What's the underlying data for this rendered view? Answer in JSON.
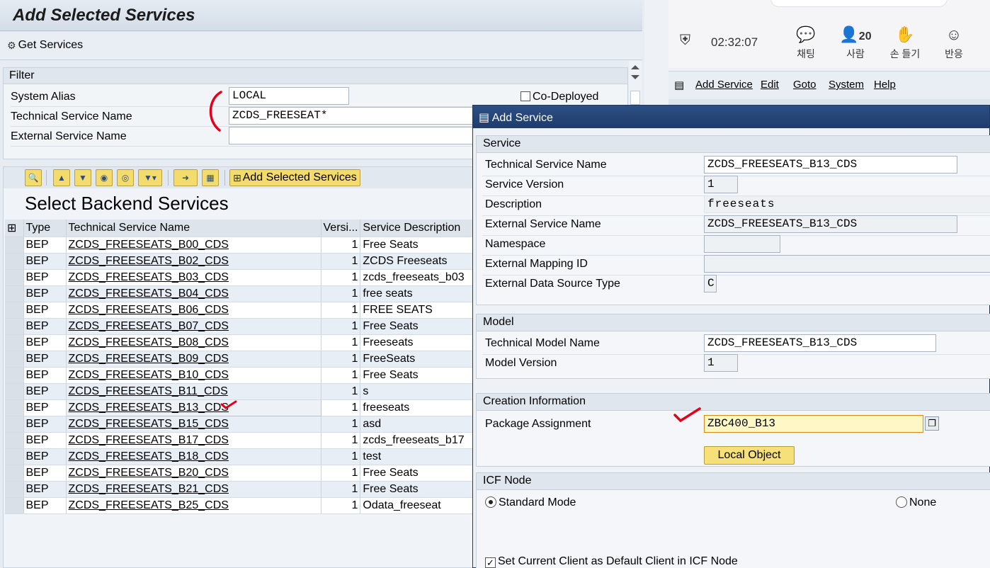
{
  "main_window": {
    "title": "Add Selected Services",
    "get_services_label": "Get Services"
  },
  "filter": {
    "header": "Filter",
    "system_alias_label": "System Alias",
    "system_alias_value": "LOCAL",
    "technical_service_name_label": "Technical Service Name",
    "technical_service_name_value": "ZCDS_FREESEAT*",
    "external_service_name_label": "External Service Name",
    "external_service_name_value": "",
    "co_deployed_label": "Co-Deployed"
  },
  "toolbar": {
    "add_selected_services_label": "Add Selected Services"
  },
  "grid": {
    "title": "Select Backend Services",
    "columns": [
      "Type",
      "Technical Service Name",
      "Versi...",
      "Service Description"
    ],
    "rows": [
      {
        "type": "BEP",
        "name": "ZCDS_FREESEATS_B00_CDS",
        "version": "1",
        "description": "Free Seats"
      },
      {
        "type": "BEP",
        "name": "ZCDS_FREESEATS_B02_CDS",
        "version": "1",
        "description": "ZCDS Freeseats"
      },
      {
        "type": "BEP",
        "name": "ZCDS_FREESEATS_B03_CDS",
        "version": "1",
        "description": "zcds_freeseats_b03"
      },
      {
        "type": "BEP",
        "name": "ZCDS_FREESEATS_B04_CDS",
        "version": "1",
        "description": "free seats"
      },
      {
        "type": "BEP",
        "name": "ZCDS_FREESEATS_B06_CDS",
        "version": "1",
        "description": "FREE SEATS"
      },
      {
        "type": "BEP",
        "name": "ZCDS_FREESEATS_B07_CDS",
        "version": "1",
        "description": "Free Seats"
      },
      {
        "type": "BEP",
        "name": "ZCDS_FREESEATS_B08_CDS",
        "version": "1",
        "description": "Freeseats"
      },
      {
        "type": "BEP",
        "name": "ZCDS_FREESEATS_B09_CDS",
        "version": "1",
        "description": "FreeSeats"
      },
      {
        "type": "BEP",
        "name": "ZCDS_FREESEATS_B10_CDS",
        "version": "1",
        "description": "Free Seats"
      },
      {
        "type": "BEP",
        "name": "ZCDS_FREESEATS_B11_CDS",
        "version": "1",
        "description": "s"
      },
      {
        "type": "BEP",
        "name": "ZCDS_FREESEATS_B13_CDS",
        "version": "1",
        "description": "freeseats"
      },
      {
        "type": "BEP",
        "name": "ZCDS_FREESEATS_B15_CDS",
        "version": "1",
        "description": "asd"
      },
      {
        "type": "BEP",
        "name": "ZCDS_FREESEATS_B17_CDS",
        "version": "1",
        "description": "zcds_freeseats_b17"
      },
      {
        "type": "BEP",
        "name": "ZCDS_FREESEATS_B18_CDS",
        "version": "1",
        "description": "test"
      },
      {
        "type": "BEP",
        "name": "ZCDS_FREESEATS_B20_CDS",
        "version": "1",
        "description": "Free Seats"
      },
      {
        "type": "BEP",
        "name": "ZCDS_FREESEATS_B21_CDS",
        "version": "1",
        "description": "Free Seats"
      },
      {
        "type": "BEP",
        "name": "ZCDS_FREESEATS_B25_CDS",
        "version": "1",
        "description": "Odata_freeseat"
      }
    ]
  },
  "meeting": {
    "timer": "02:32:07",
    "chat_label": "채팅",
    "people_label": "사람",
    "people_count": "20",
    "raise_hand_label": "손 들기",
    "reactions_label": "반응"
  },
  "sap_menu": {
    "items": [
      "Add Service",
      "Edit",
      "Goto",
      "System",
      "Help"
    ]
  },
  "dialog": {
    "title": "Add Service",
    "service_group": "Service",
    "technical_service_name_label": "Technical Service Name",
    "technical_service_name_value": "ZCDS_FREESEATS_B13_CDS",
    "service_version_label": "Service Version",
    "service_version_value": "1",
    "description_label": "Description",
    "description_value": "freeseats",
    "external_service_name_label": "External Service Name",
    "external_service_name_value": "ZCDS_FREESEATS_B13_CDS",
    "namespace_label": "Namespace",
    "namespace_value": "",
    "external_mapping_id_label": "External Mapping ID",
    "external_mapping_id_value": "",
    "external_data_source_type_label": "External Data Source Type",
    "external_data_source_type_value": "C",
    "model_group": "Model",
    "technical_model_name_label": "Technical Model Name",
    "technical_model_name_value": "ZCDS_FREESEATS_B13_CDS",
    "model_version_label": "Model Version",
    "model_version_value": "1",
    "creation_group": "Creation Information",
    "package_assignment_label": "Package Assignment",
    "package_assignment_value": "ZBC400_B13",
    "local_object_label": "Local Object",
    "icf_group": "ICF Node",
    "standard_mode_label": "Standard Mode",
    "none_label": "None",
    "set_default_client_label": "Set Current Client as Default Client in ICF Node"
  },
  "colors": {
    "dialog_title_bg": "#1f3c6b",
    "button_yellow": "#f4dc6c",
    "annotation_red": "#e3001b"
  }
}
